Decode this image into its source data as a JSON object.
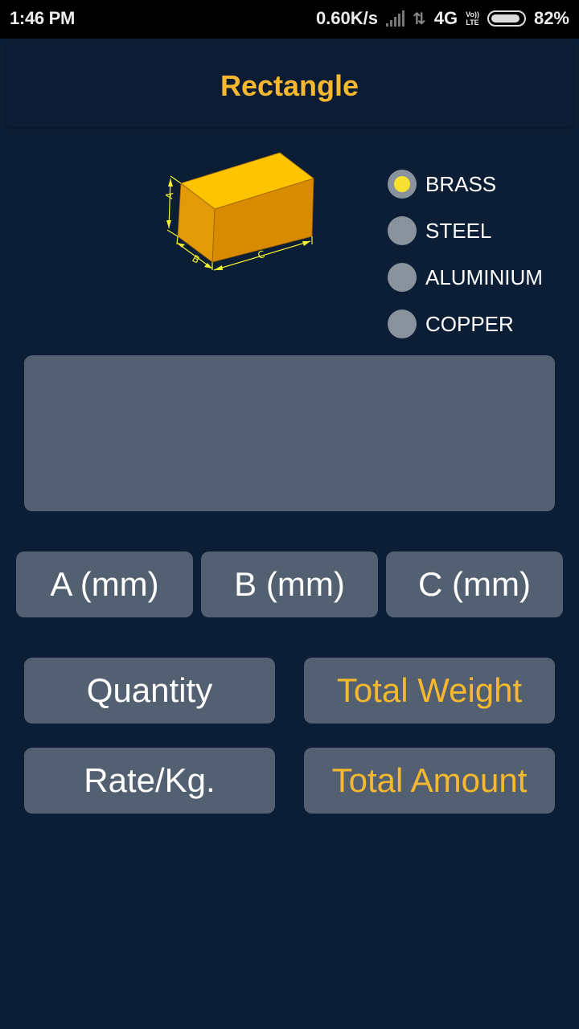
{
  "status_bar": {
    "time": "1:46 PM",
    "network_speed": "0.60K/s",
    "network_type": "4G",
    "volte_top": "Vo))",
    "volte_bottom": "LTE",
    "battery_percent": "82%",
    "battery_level": 0.82,
    "icons": [
      "signal-icon",
      "data-arrows-icon",
      "volte-icon",
      "battery-icon"
    ]
  },
  "header": {
    "title": "Rectangle"
  },
  "diagram": {
    "icon": "rectangular-block-icon",
    "labels": {
      "a": "A",
      "b": "B",
      "c": "C"
    },
    "colors": {
      "top": "#fec400",
      "front": "#d88a00",
      "side": "#e79c05",
      "dimension": "#f2f230"
    }
  },
  "materials": {
    "selected": "BRASS",
    "options": [
      {
        "label": "BRASS",
        "selected": true
      },
      {
        "label": "STEEL",
        "selected": false
      },
      {
        "label": "ALUMINIUM",
        "selected": false
      },
      {
        "label": "COPPER",
        "selected": false
      }
    ]
  },
  "result_display": {
    "text": ""
  },
  "dimensions": {
    "a_label": "A (mm)",
    "b_label": "B (mm)",
    "c_label": "C (mm)"
  },
  "inputs": {
    "quantity_label": "Quantity",
    "rate_label": "Rate/Kg."
  },
  "outputs": {
    "total_weight_label": "Total Weight",
    "total_amount_label": "Total Amount"
  },
  "colors": {
    "background": "#0c1e36",
    "accent": "#f5b82e",
    "panel": "#536071",
    "radio_selected": "#f7e130",
    "radio_unselected": "#8a929d"
  }
}
